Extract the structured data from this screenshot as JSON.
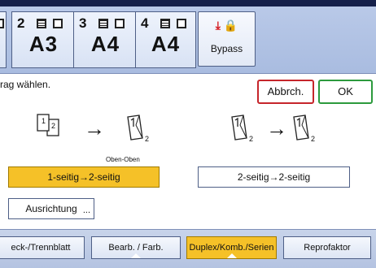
{
  "trays": [
    {
      "num": "2",
      "size": "A3"
    },
    {
      "num": "3",
      "size": "A4"
    },
    {
      "num": "4",
      "size": "A4"
    }
  ],
  "bypass": {
    "label": "Bypass",
    "icons": [
      "paper-feed-arrow-icon",
      "lock-icon"
    ]
  },
  "message": "rag wählen.",
  "buttons": {
    "cancel": "Abbrch.",
    "ok": "OK"
  },
  "diagrams": {
    "left_page_numbers": [
      "1",
      "2"
    ],
    "left_result_number": "2",
    "right_source_number": "2",
    "right_result_number": "2",
    "caption": "Oben-Oben"
  },
  "options": {
    "one_to_two": "1-seitig→2-seitig",
    "two_to_two": "2-seitig→2-seitig",
    "orientation": "Ausrichtung",
    "orientation_more": "..."
  },
  "tabs": [
    {
      "label": "eck-/Trennblatt"
    },
    {
      "label": "Bearb. / Farb."
    },
    {
      "label": "Duplex/Komb./Serien"
    },
    {
      "label": "Reprofaktor"
    }
  ],
  "colors": {
    "selected": "#f5c128",
    "cancel_border": "#c6252b",
    "ok_border": "#2c9a3d"
  }
}
